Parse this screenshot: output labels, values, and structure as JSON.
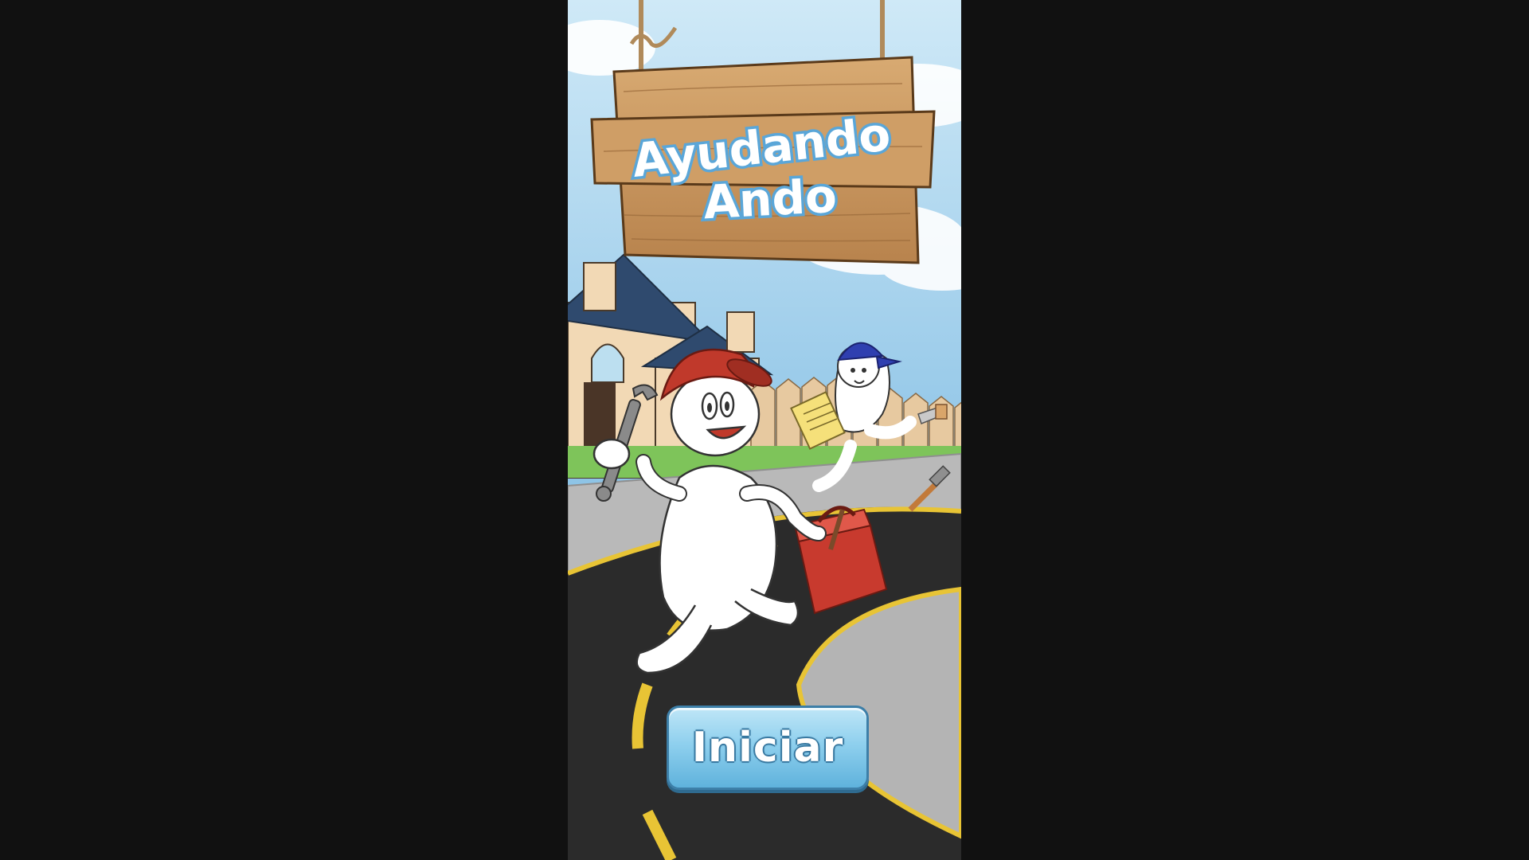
{
  "game": {
    "title_line1": "Ayudando",
    "title_line2": "Ando",
    "start_button": "Iniciar"
  },
  "colors": {
    "sky": "#a9d6ee",
    "wood": "#c99a63",
    "road": "#2b2b2b",
    "road_stripe": "#e8c435",
    "button": "#7cc6ea",
    "hat_red": "#c0392b",
    "hat_blue": "#2f3fb0"
  },
  "icons": [
    "rope-icon",
    "wrench-icon",
    "notepad-icon",
    "toolbox-icon",
    "hammer-icon",
    "saw-icon"
  ]
}
